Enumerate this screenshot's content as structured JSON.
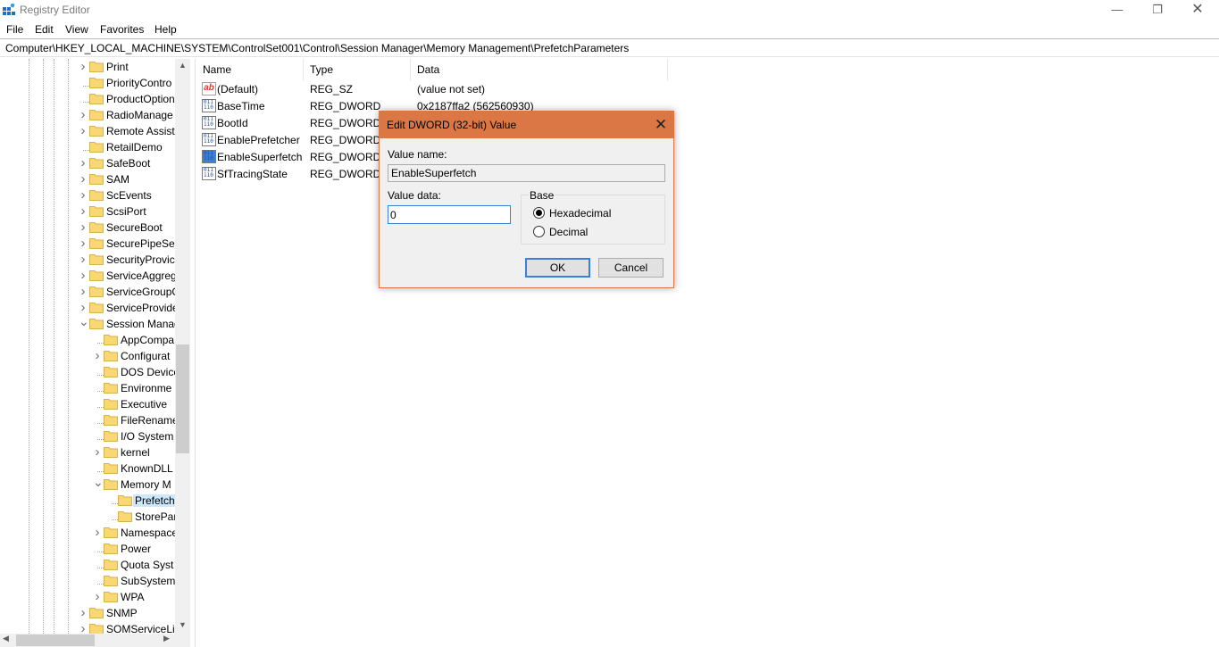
{
  "window": {
    "title": "Registry Editor",
    "minimize_glyph": "—",
    "maximize_glyph": "❐",
    "close_glyph": "✕"
  },
  "menu": [
    "File",
    "Edit",
    "View",
    "Favorites",
    "Help"
  ],
  "address": "Computer\\HKEY_LOCAL_MACHINE\\SYSTEM\\ControlSet001\\Control\\Session Manager\\Memory Management\\PrefetchParameters",
  "tree": [
    {
      "label": "Print",
      "level": 0,
      "expander": "closed"
    },
    {
      "label": "PriorityContro",
      "level": 0,
      "expander": "none"
    },
    {
      "label": "ProductOption",
      "level": 0,
      "expander": "none"
    },
    {
      "label": "RadioManage",
      "level": 0,
      "expander": "closed"
    },
    {
      "label": "Remote Assist",
      "level": 0,
      "expander": "closed"
    },
    {
      "label": "RetailDemo",
      "level": 0,
      "expander": "none"
    },
    {
      "label": "SafeBoot",
      "level": 0,
      "expander": "closed"
    },
    {
      "label": "SAM",
      "level": 0,
      "expander": "closed"
    },
    {
      "label": "ScEvents",
      "level": 0,
      "expander": "closed"
    },
    {
      "label": "ScsiPort",
      "level": 0,
      "expander": "closed"
    },
    {
      "label": "SecureBoot",
      "level": 0,
      "expander": "closed"
    },
    {
      "label": "SecurePipeSer",
      "level": 0,
      "expander": "closed"
    },
    {
      "label": "SecurityProvic",
      "level": 0,
      "expander": "closed"
    },
    {
      "label": "ServiceAggreg",
      "level": 0,
      "expander": "closed"
    },
    {
      "label": "ServiceGroupC",
      "level": 0,
      "expander": "closed"
    },
    {
      "label": "ServiceProvide",
      "level": 0,
      "expander": "closed"
    },
    {
      "label": "Session Manag",
      "level": 0,
      "expander": "open"
    },
    {
      "label": "AppCompa",
      "level": 1,
      "expander": "none"
    },
    {
      "label": "Configurat",
      "level": 1,
      "expander": "closed"
    },
    {
      "label": "DOS Device",
      "level": 1,
      "expander": "none"
    },
    {
      "label": "Environme",
      "level": 1,
      "expander": "none"
    },
    {
      "label": "Executive",
      "level": 1,
      "expander": "none"
    },
    {
      "label": "FileRename",
      "level": 1,
      "expander": "none"
    },
    {
      "label": "I/O System",
      "level": 1,
      "expander": "none"
    },
    {
      "label": "kernel",
      "level": 1,
      "expander": "closed"
    },
    {
      "label": "KnownDLL",
      "level": 1,
      "expander": "none"
    },
    {
      "label": "Memory M",
      "level": 1,
      "expander": "open"
    },
    {
      "label": "Prefetch",
      "level": 2,
      "expander": "none",
      "selected": true
    },
    {
      "label": "StorePar",
      "level": 2,
      "expander": "none"
    },
    {
      "label": "Namespace",
      "level": 1,
      "expander": "closed"
    },
    {
      "label": "Power",
      "level": 1,
      "expander": "none"
    },
    {
      "label": "Quota Syst",
      "level": 1,
      "expander": "none"
    },
    {
      "label": "SubSystem",
      "level": 1,
      "expander": "none"
    },
    {
      "label": "WPA",
      "level": 1,
      "expander": "closed"
    },
    {
      "label": "SNMP",
      "level": 0,
      "expander": "closed"
    },
    {
      "label": "SOMServiceLis",
      "level": 0,
      "expander": "closed"
    }
  ],
  "columns": {
    "name": "Name",
    "type": "Type",
    "data": "Data"
  },
  "values": [
    {
      "icon": "string",
      "name": "(Default)",
      "type": "REG_SZ",
      "data": "(value not set)"
    },
    {
      "icon": "binary",
      "name": "BaseTime",
      "type": "REG_DWORD",
      "data": "0x2187ffa2 (562560930)"
    },
    {
      "icon": "binary",
      "name": "BootId",
      "type": "REG_DWORD",
      "data": ""
    },
    {
      "icon": "binary",
      "name": "EnablePrefetcher",
      "type": "REG_DWORD",
      "data": ""
    },
    {
      "icon": "binary-selected",
      "name": "EnableSuperfetch",
      "type": "REG_DWORD",
      "data": ""
    },
    {
      "icon": "binary",
      "name": "SfTracingState",
      "type": "REG_DWORD",
      "data": ""
    }
  ],
  "dialog": {
    "title": "Edit DWORD (32-bit) Value",
    "close_glyph": "✕",
    "value_name_label": "Value name:",
    "value_name": "EnableSuperfetch",
    "value_data_label": "Value data:",
    "value_data": "0",
    "base_label": "Base",
    "hex_label": "Hexadecimal",
    "dec_label": "Decimal",
    "selected_base": "hex",
    "ok_label": "OK",
    "cancel_label": "Cancel"
  },
  "colors": {
    "accent": "#da7745",
    "selection": "#cce8ff",
    "folder": "#f8d775",
    "focus": "#3c7fd8"
  }
}
